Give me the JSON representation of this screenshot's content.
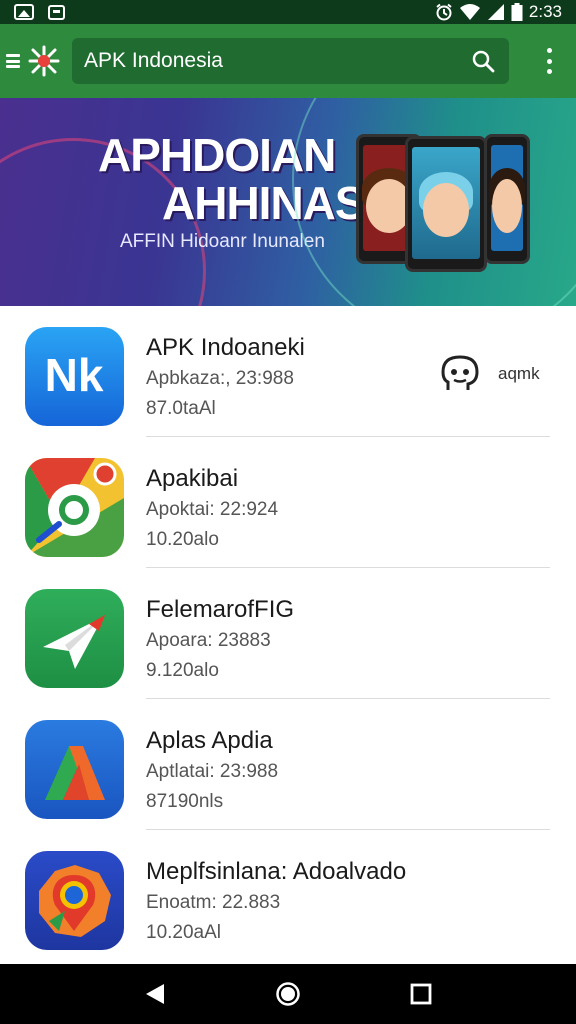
{
  "status_bar": {
    "time": "2:33"
  },
  "app_bar": {
    "search_text": "APK Indonesia"
  },
  "banner": {
    "title_line1": "APHDOIAN",
    "title_line2": "AHHINAS",
    "subtitle": "AFFIN Hidoanr Inunalen"
  },
  "apps": [
    {
      "name": "APK Indoaneki",
      "meta1": "Apbkaza:, 23:988",
      "meta2": "87.0taAl",
      "action_label": "aqmk",
      "icon_text": "Nk"
    },
    {
      "name": "Apakibai",
      "meta1": "Apoktai: 22:924",
      "meta2": "10.20alo"
    },
    {
      "name": "FelemarofFIG",
      "meta1": "Apoara: 23883",
      "meta2": "9.120alo"
    },
    {
      "name": "Aplas Apdia",
      "meta1": "Aptlatai: 23:988",
      "meta2": "87190nls"
    },
    {
      "name": "Meplfsinlana: Adoalvado",
      "meta1": "Enoatm: 22.883",
      "meta2": "10.20aAl"
    }
  ],
  "icons": {
    "status": [
      "gallery-icon",
      "message-icon",
      "alarm-icon",
      "wifi-icon",
      "signal-icon",
      "battery-icon"
    ],
    "nav": [
      "back-icon",
      "home-icon",
      "recents-icon"
    ]
  },
  "colors": {
    "status_bar": "#0d3a1a",
    "app_bar": "#2e8b3e",
    "search_box": "#1f6b30"
  }
}
